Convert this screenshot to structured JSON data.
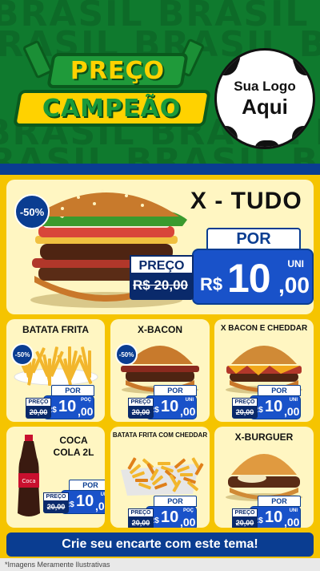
{
  "header": {
    "watermark": "BRASIL BRASIL BRASIL",
    "banner_line1": "PREÇO",
    "banner_line2": "CAMPEÃO",
    "logo_line1": "Sua Logo",
    "logo_line2": "Aqui"
  },
  "hero": {
    "title": "X - TUDO",
    "discount": "-50%",
    "por_label": "POR",
    "preco_label": "PREÇO",
    "old_price": "R$ 20,00",
    "currency": "R$",
    "price_int": "10",
    "price_cents": ",00",
    "unit": "UNI"
  },
  "products": [
    {
      "title": "BATATA FRITA",
      "discount": "-50%",
      "preco_label": "PREÇO",
      "old_price": "20,00",
      "por_label": "POR",
      "currency": "R$",
      "price_int": "10",
      "price_cents": ",00",
      "unit": "POÇ"
    },
    {
      "title": "X-BACON",
      "discount": "-50%",
      "preco_label": "PREÇO",
      "old_price": "20,00",
      "por_label": "POR",
      "currency": "R$",
      "price_int": "10",
      "price_cents": ",00",
      "unit": "UNI"
    },
    {
      "title": "X BACON E CHEDDAR",
      "discount": "",
      "preco_label": "PREÇO",
      "old_price": "20,00",
      "por_label": "POR",
      "currency": "R$",
      "price_int": "10",
      "price_cents": ",00",
      "unit": "UNI"
    },
    {
      "title": "COCA COLA 2L",
      "discount": "",
      "preco_label": "PREÇO",
      "old_price": "20,00",
      "por_label": "POR",
      "currency": "R$",
      "price_int": "10",
      "price_cents": ",00",
      "unit": "UNI"
    },
    {
      "title": "BATATA FRITA COM CHEDDAR",
      "discount": "",
      "preco_label": "PREÇO",
      "old_price": "20,00",
      "por_label": "POR",
      "currency": "R$",
      "price_int": "10",
      "price_cents": ",00",
      "unit": "POÇ"
    },
    {
      "title": "X-BURGUER",
      "discount": "",
      "preco_label": "PREÇO",
      "old_price": "20,00",
      "por_label": "POR",
      "currency": "R$",
      "price_int": "10",
      "price_cents": ",00",
      "unit": "UNI"
    }
  ],
  "footer": {
    "cta": "Crie seu encarte com este tema!",
    "disclaimer": "*Imagens Meramente Ilustrativas"
  },
  "colors": {
    "green": "#0f7a2e",
    "yellow": "#f5c400",
    "blue": "#1952c9",
    "navy": "#0a3d91"
  }
}
